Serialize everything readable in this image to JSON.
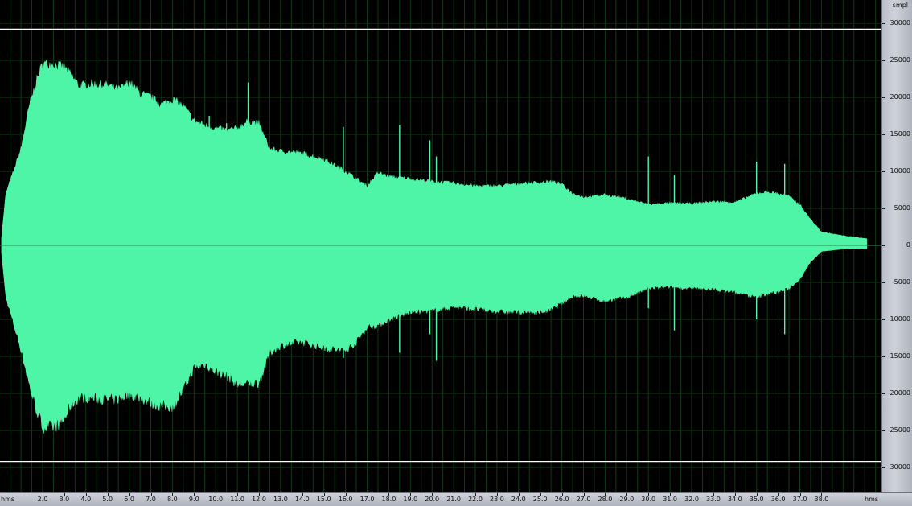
{
  "app": {
    "type": "audio-waveform-editor"
  },
  "colors": {
    "background": "#000000",
    "grid": "#0f3a14",
    "waveform": "#4ef5a6",
    "clip_line": "#ffffff",
    "center_line": "#2a8a5a"
  },
  "y_axis": {
    "unit": "smpl",
    "labels": [
      "30000",
      "25000",
      "20000",
      "15000",
      "10000",
      "5000",
      "0",
      "-5000",
      "-10000",
      "-15000",
      "-20000",
      "-25000",
      "-30000"
    ],
    "values": [
      30000,
      25000,
      20000,
      15000,
      10000,
      5000,
      0,
      -5000,
      -10000,
      -15000,
      -20000,
      -25000,
      -30000
    ],
    "clip_level": 29200
  },
  "x_axis": {
    "unit_left": "hms",
    "unit_right": "hms",
    "labels": [
      "2.0",
      "3.0",
      "4.0",
      "5.0",
      "6.0",
      "7.0",
      "8.0",
      "9.0",
      "10.0",
      "11.0",
      "12.0",
      "13.0",
      "14.0",
      "15.0",
      "16.0",
      "17.0",
      "18.0",
      "19.0",
      "20.0",
      "21.0",
      "22.0",
      "23.0",
      "24.0",
      "25.0",
      "26.0",
      "27.0",
      "28.0",
      "29.0",
      "30.0",
      "31.0",
      "32.0",
      "33.0",
      "34.0",
      "35.0",
      "36.0",
      "37.0",
      "38.0"
    ],
    "values": [
      2,
      3,
      4,
      5,
      6,
      7,
      8,
      9,
      10,
      11,
      12,
      13,
      14,
      15,
      16,
      17,
      18,
      19,
      20,
      21,
      22,
      23,
      24,
      25,
      26,
      27,
      28,
      29,
      30,
      31,
      32,
      33,
      34,
      35,
      36,
      37,
      38
    ],
    "range": [
      0.1,
      40.1
    ]
  },
  "waveform": {
    "time": [
      0.1,
      0.3,
      0.6,
      1.0,
      1.4,
      1.7,
      2.0,
      2.5,
      3.0,
      3.3,
      3.7,
      4.2,
      5.0,
      5.5,
      6.0,
      6.5,
      7.0,
      7.5,
      8.0,
      8.5,
      9.0,
      9.5,
      10.0,
      10.5,
      11.0,
      11.5,
      12.0,
      12.5,
      13.0,
      14.0,
      15.0,
      16.0,
      16.5,
      17.0,
      17.5,
      18.0,
      19.0,
      20.0,
      21.0,
      22.0,
      23.0,
      24.0,
      25.0,
      25.5,
      26.0,
      26.5,
      27.0,
      28.0,
      29.0,
      30.0,
      31.0,
      32.0,
      33.0,
      34.0,
      35.0,
      35.5,
      36.0,
      36.5,
      37.0,
      37.5,
      38.0,
      39.0,
      40.1
    ],
    "upper": [
      1000,
      7000,
      9500,
      13000,
      19000,
      22000,
      24500,
      24500,
      24000,
      23000,
      21500,
      21800,
      21600,
      21000,
      22000,
      20500,
      20000,
      19000,
      19700,
      18800,
      16800,
      16200,
      15800,
      15500,
      15800,
      16800,
      16400,
      13000,
      12700,
      12400,
      11600,
      10000,
      9000,
      8000,
      9800,
      9300,
      9000,
      8600,
      8400,
      8000,
      8000,
      8300,
      8500,
      8600,
      8200,
      7000,
      6500,
      6800,
      6300,
      5500,
      5700,
      5600,
      5900,
      5800,
      7000,
      7200,
      7000,
      6600,
      5500,
      3500,
      1800,
      1300,
      900
    ],
    "lower": [
      -1000,
      -7000,
      -10000,
      -14000,
      -19000,
      -22000,
      -24500,
      -24500,
      -23500,
      -21500,
      -20500,
      -20500,
      -20800,
      -20700,
      -20000,
      -20500,
      -21200,
      -21700,
      -21700,
      -19500,
      -16500,
      -16000,
      -17000,
      -17500,
      -18700,
      -18700,
      -18500,
      -14500,
      -13500,
      -13000,
      -13800,
      -14200,
      -13000,
      -11000,
      -10800,
      -10000,
      -9000,
      -8800,
      -8300,
      -8600,
      -8900,
      -9000,
      -9000,
      -8700,
      -7800,
      -6800,
      -6800,
      -7500,
      -7000,
      -5800,
      -5600,
      -5800,
      -5900,
      -6300,
      -7000,
      -6500,
      -6300,
      -5800,
      -4500,
      -2200,
      -800,
      -500,
      -500
    ],
    "spikes": [
      {
        "t": 11.5,
        "max": 22000,
        "min": -15000
      },
      {
        "t": 15.9,
        "max": 16000,
        "min": -15200
      },
      {
        "t": 18.5,
        "max": 16200,
        "min": -14500
      },
      {
        "t": 19.9,
        "max": 14200,
        "min": -12000
      },
      {
        "t": 20.2,
        "max": 12000,
        "min": -15600
      },
      {
        "t": 30.0,
        "max": 12000,
        "min": -8500
      },
      {
        "t": 31.2,
        "max": 9500,
        "min": -11500
      },
      {
        "t": 35.0,
        "max": 11300,
        "min": -10000
      },
      {
        "t": 36.3,
        "max": 11000,
        "min": -12000
      },
      {
        "t": 9.7,
        "max": 17500,
        "min": -11000
      },
      {
        "t": 10.5,
        "max": 16500,
        "min": -10500
      }
    ]
  }
}
